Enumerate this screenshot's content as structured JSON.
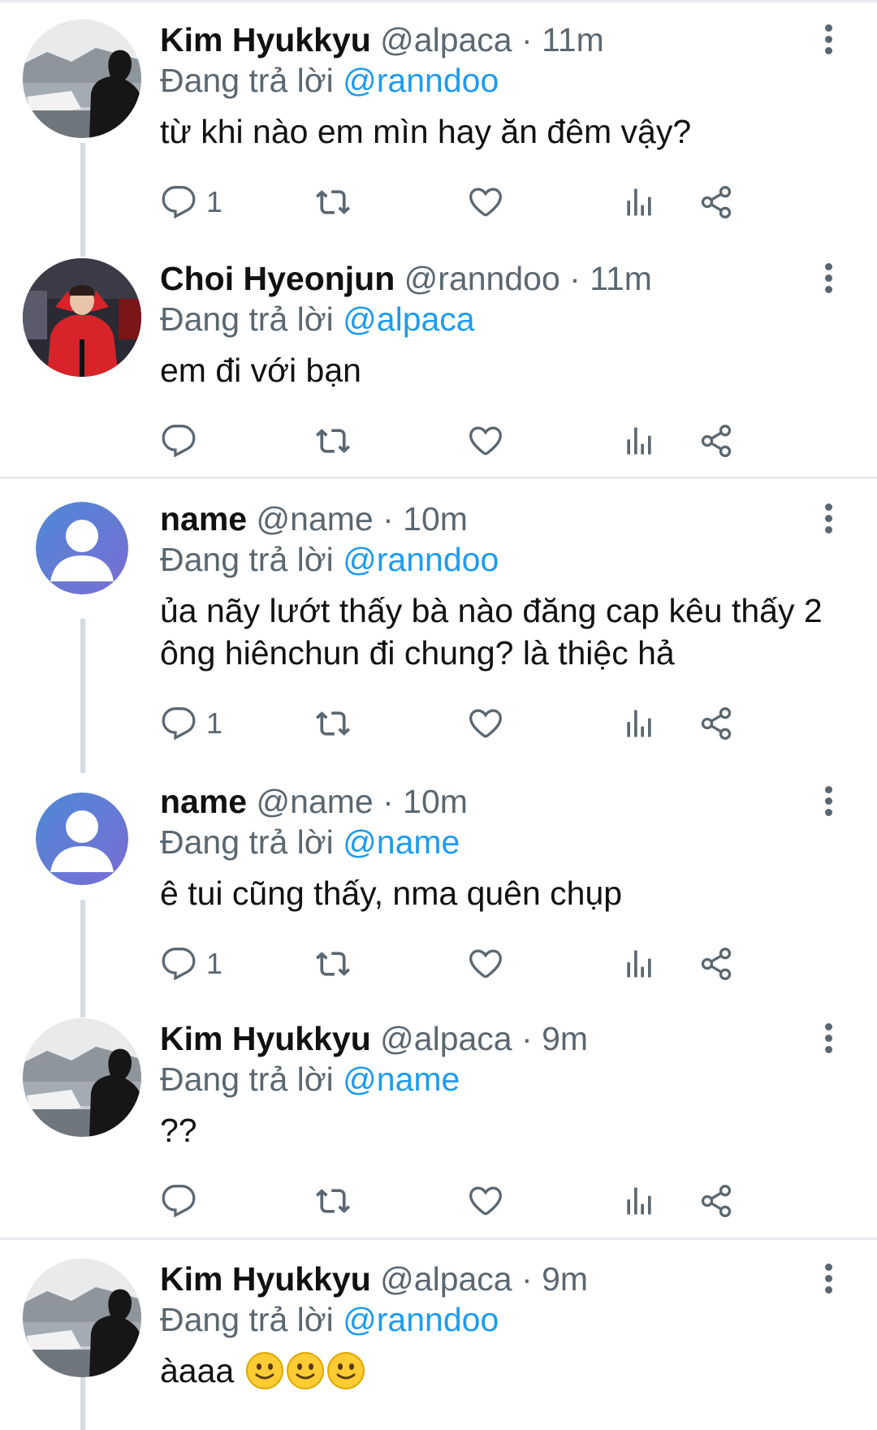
{
  "colors": {
    "mention": "#1d9bf0",
    "muted": "#5b6770",
    "text": "#111111",
    "thread_line": "#d6dbe0"
  },
  "icons": [
    "comment-icon",
    "retweet-icon",
    "heart-icon",
    "views-icon",
    "share-icon",
    "more-icon"
  ],
  "tweets": [
    {
      "name": "Kim Hyukkyu",
      "handle": "@alpaca",
      "dot": "·",
      "time": "11m",
      "reply_prefix": "Đang trả lời",
      "mention": "@ranndoo",
      "text": "từ khi nào em mìn hay ăn đêm vậy?",
      "reply_count": "1"
    },
    {
      "name": "Choi Hyeonjun",
      "handle": "@ranndoo",
      "dot": "·",
      "time": "11m",
      "reply_prefix": "Đang trả lời",
      "mention": "@alpaca",
      "text": "em đi với bạn",
      "reply_count": ""
    },
    {
      "name": "name",
      "handle": "@name",
      "dot": "·",
      "time": "10m",
      "reply_prefix": "Đang trả lời",
      "mention": "@ranndoo",
      "text": "ủa nãy lướt thấy bà nào đăng cap kêu thấy 2 ông hiênchun đi chung? là thiệc hả",
      "reply_count": "1"
    },
    {
      "name": "name",
      "handle": "@name",
      "dot": "·",
      "time": "10m",
      "reply_prefix": "Đang trả lời",
      "mention": "@name",
      "text": "ê tui cũng thấy, nma quên chụp",
      "reply_count": "1"
    },
    {
      "name": "Kim Hyukkyu",
      "handle": "@alpaca",
      "dot": "·",
      "time": "9m",
      "reply_prefix": "Đang trả lời",
      "mention": "@name",
      "text": "??",
      "reply_count": ""
    },
    {
      "name": "Kim Hyukkyu",
      "handle": "@alpaca",
      "dot": "·",
      "time": "9m",
      "reply_prefix": "Đang trả lời",
      "mention": "@ranndoo",
      "text": "àaaa",
      "reply_count": "",
      "emoji": [
        "slightly-smiling-face",
        "slightly-smiling-face",
        "slightly-smiling-face"
      ]
    }
  ]
}
